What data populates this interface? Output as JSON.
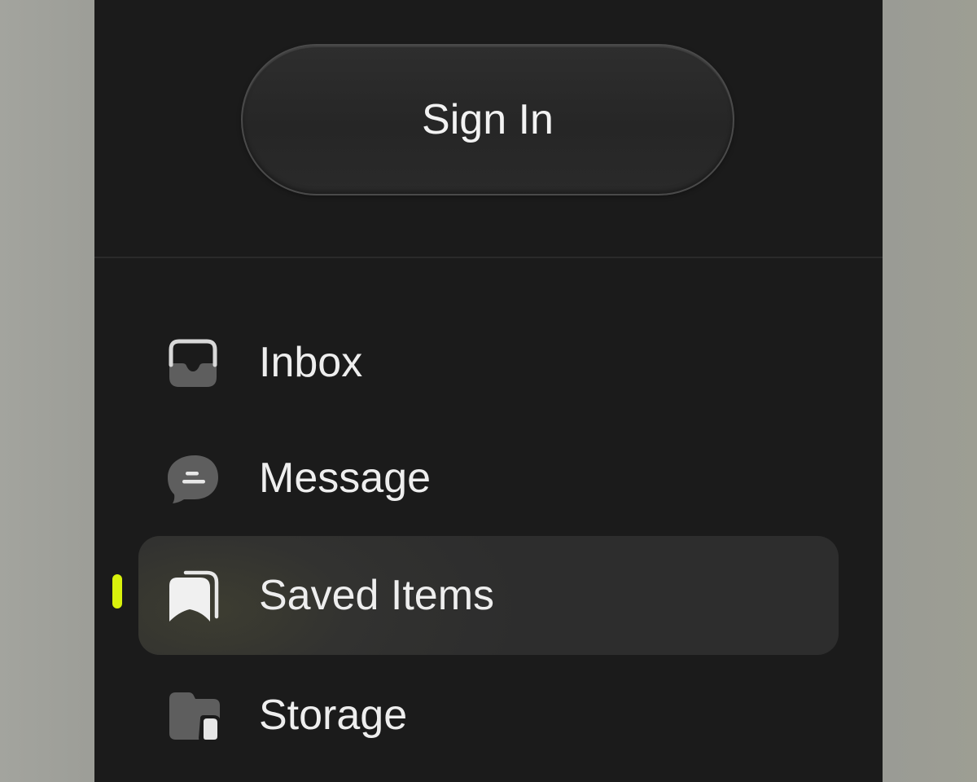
{
  "sign_in": {
    "label": "Sign In"
  },
  "nav": {
    "items": [
      {
        "label": "Inbox",
        "icon": "inbox-icon",
        "active": false
      },
      {
        "label": "Message",
        "icon": "message-icon",
        "active": false
      },
      {
        "label": "Saved Items",
        "icon": "bookmark-stack-icon",
        "active": true
      },
      {
        "label": "Storage",
        "icon": "folder-icon",
        "active": false
      }
    ]
  },
  "colors": {
    "panel_bg": "#1b1b1b",
    "accent_indicator": "#d9f20c",
    "active_item_bg": "#2d2d2d",
    "text": "#eeeeee",
    "icon_dim": "#5e5e5e",
    "icon_light": "#e8e8e8"
  }
}
